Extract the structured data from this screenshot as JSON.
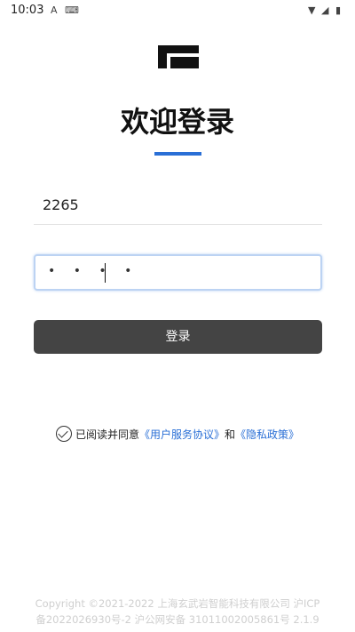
{
  "status": {
    "time": "10:03",
    "icons": [
      "a-icon",
      "keyboard-icon",
      "wifi-icon",
      "signal-icon",
      "battery-icon"
    ]
  },
  "header": {
    "title": "欢迎登录"
  },
  "form": {
    "account_value": "2265",
    "password_masked": "• • • •",
    "login_button": "登录"
  },
  "agreement": {
    "prefix": "已阅读并同意",
    "user_agreement": "《用户服务协议》",
    "and": "和",
    "privacy_policy": "《隐私政策》",
    "checked": true
  },
  "footer": {
    "line1": "Copyright ©2021-2022 上海玄武岩智能科技有限公司 沪ICP",
    "line2": "备2022026930号-2 沪公网安备 31011002005861号 2.1.9"
  },
  "colors": {
    "accent": "#2a6fd6",
    "button": "#444444"
  }
}
